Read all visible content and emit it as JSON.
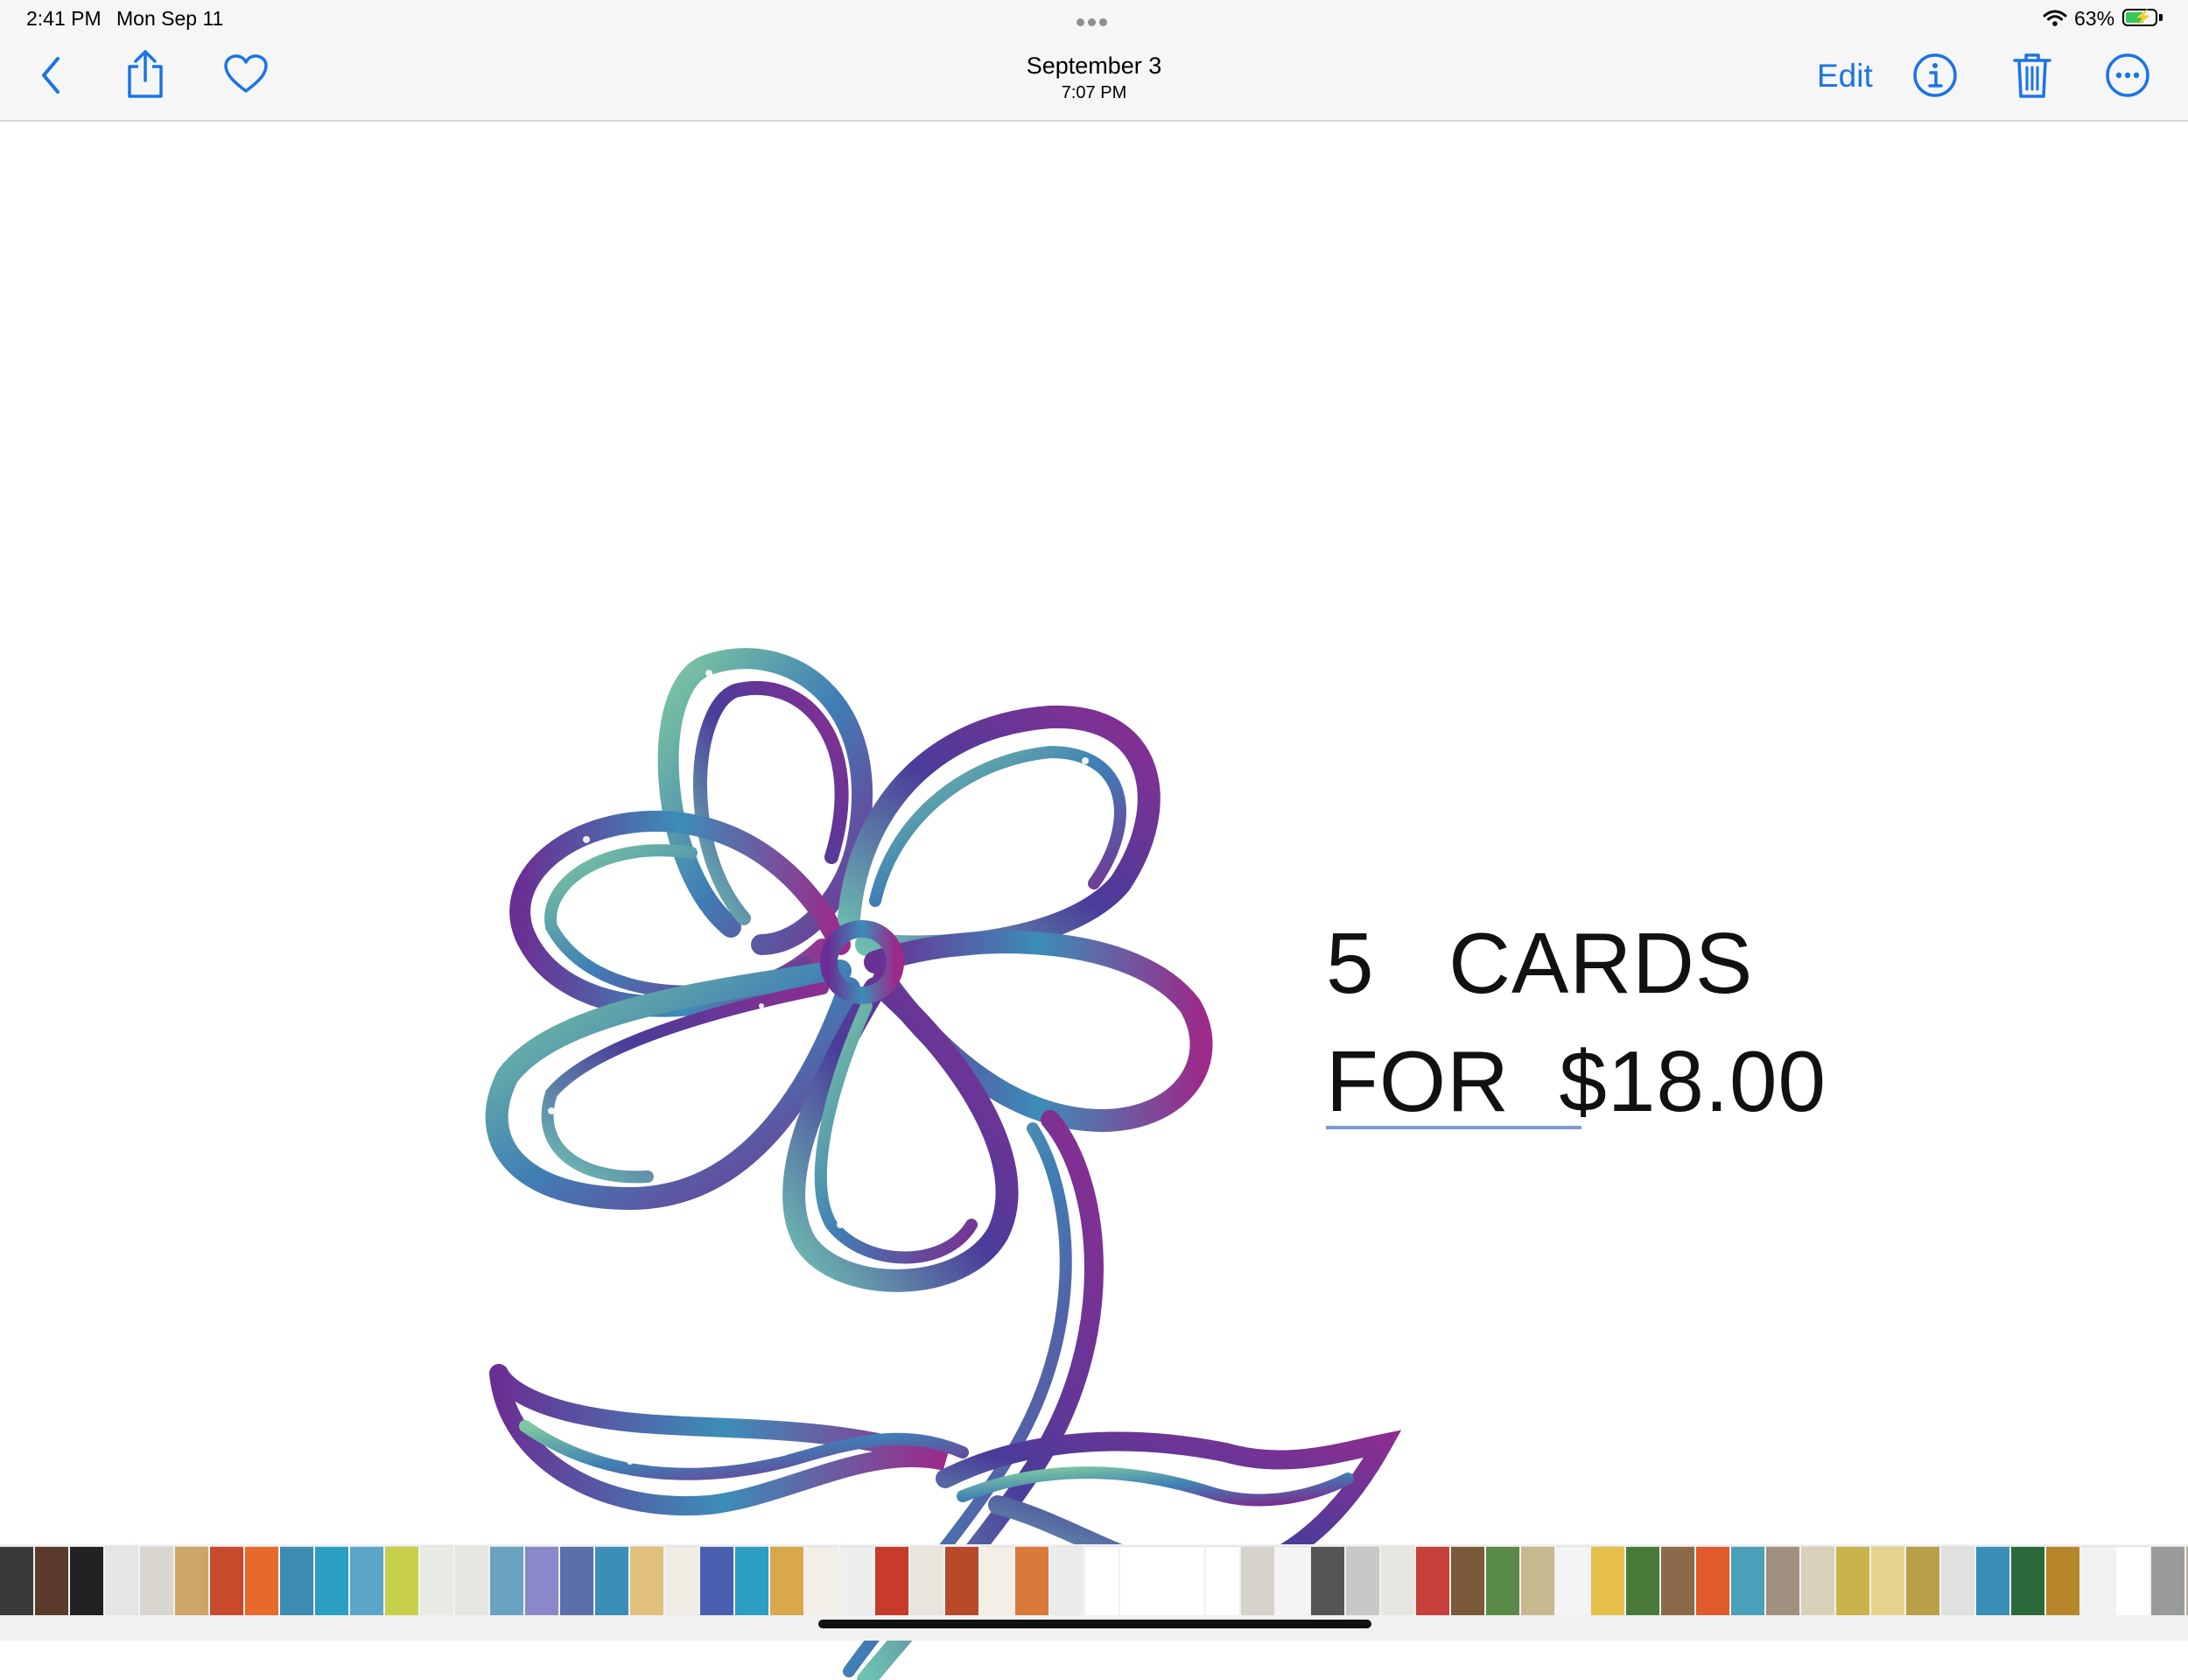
{
  "status_bar": {
    "time": "2:41 PM",
    "date": "Mon Sep 11",
    "battery_percent": "63%",
    "battery_level": 0.63,
    "charging": true
  },
  "nav": {
    "title": "September 3",
    "subtitle": "7:07 PM",
    "edit_label": "Edit",
    "icons": [
      "back-chevron-icon",
      "share-icon",
      "heart-icon",
      "info-icon",
      "trash-icon",
      "more-icon"
    ],
    "accent_color": "#1a73e8"
  },
  "photo": {
    "line1": "5   CARDS",
    "line2": "FOR  $18.00"
  },
  "thumbnail_strip": {
    "colors": [
      "#3a3a3a",
      "#5a3b2b",
      "#222222",
      "#e5e5e5",
      "#d8d6cf",
      "#cda566",
      "#c94a2a",
      "#e86a2a",
      "#3d8bb0",
      "#2a9fc2",
      "#5aa5c8",
      "#c8d04a",
      "#eaeae5",
      "#e6e6e2",
      "#6aa2c0",
      "#8a88c8",
      "#5a6fa8",
      "#3a8fb8",
      "#e0c07a",
      "#f0ece6",
      "#4a5fb0",
      "#2a9fc2",
      "#d8a84a",
      "#f3efe8",
      "#eeeeee",
      "#c83a2a",
      "#e8e4de",
      "#b84a2a",
      "#f4efe6",
      "#d97a3a",
      "#ebebeb",
      "#ffffff",
      "#ffffff",
      "#ffffff",
      "#d6d2cc",
      "#f4f4f4",
      "#555555",
      "#c8c8c8",
      "#e8e6e0",
      "#c8403a",
      "#7a5a3a",
      "#5a8a4a",
      "#c8b890",
      "#f4f4f4",
      "#e6c04a",
      "#4a7a3a",
      "#8a6a4a",
      "#e05a2a",
      "#4aa0b8",
      "#a09080",
      "#d8d0b8",
      "#c8b44a",
      "#e6d28a",
      "#b8a048",
      "#e0e0e0",
      "#3a8fb8",
      "#2a6a3a",
      "#b8862a",
      "#f2f2f2",
      "#ffffff",
      "#9a9a9a",
      "#b8b0a0",
      "#7aa0c0",
      "#c8b8a0",
      "#3a7a9a",
      "#4a7a4a",
      "#d8e0e8",
      "#e08a4a",
      "#f0c04a",
      "#e87a8a",
      "#f0d0a0",
      "#c8d890",
      "#d8d8d8"
    ]
  }
}
